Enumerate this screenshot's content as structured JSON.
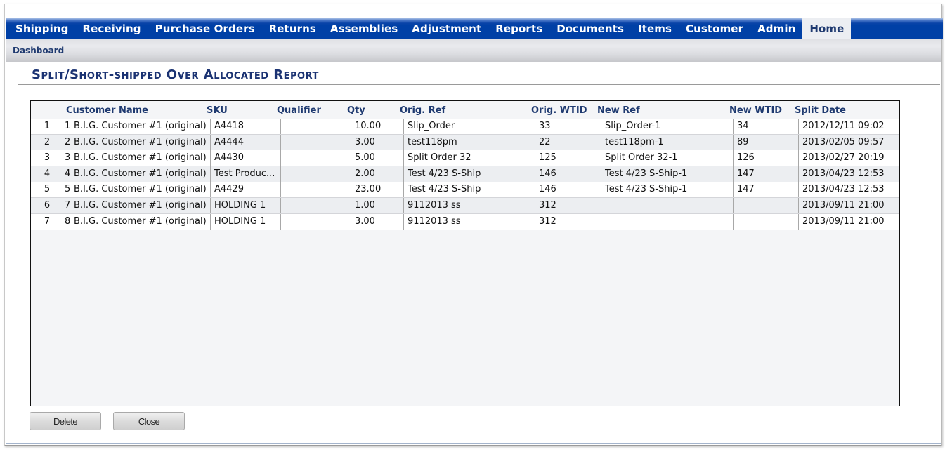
{
  "nav": {
    "items": [
      {
        "label": "Shipping",
        "active": false
      },
      {
        "label": "Receiving",
        "active": false
      },
      {
        "label": "Purchase Orders",
        "active": false
      },
      {
        "label": "Returns",
        "active": false
      },
      {
        "label": "Assemblies",
        "active": false
      },
      {
        "label": "Adjustment",
        "active": false
      },
      {
        "label": "Reports",
        "active": false
      },
      {
        "label": "Documents",
        "active": false
      },
      {
        "label": "Items",
        "active": false
      },
      {
        "label": "Customer",
        "active": false
      },
      {
        "label": "Admin",
        "active": false
      },
      {
        "label": "Home",
        "active": true
      }
    ],
    "active_color": "#0040a6"
  },
  "subnav": {
    "items": [
      {
        "label": "Dashboard"
      }
    ]
  },
  "report": {
    "title": "Split/Short-shipped Over Allocated Report"
  },
  "table": {
    "columns": [
      {
        "key": "row",
        "label": ""
      },
      {
        "key": "id",
        "label": ""
      },
      {
        "key": "customer",
        "label": "Customer Name"
      },
      {
        "key": "sku",
        "label": "SKU"
      },
      {
        "key": "qualifier",
        "label": "Qualifier"
      },
      {
        "key": "qty",
        "label": "Qty"
      },
      {
        "key": "orig_ref",
        "label": "Orig. Ref"
      },
      {
        "key": "orig_wtid",
        "label": "Orig. WTID"
      },
      {
        "key": "new_ref",
        "label": "New Ref"
      },
      {
        "key": "new_wtid",
        "label": "New WTID"
      },
      {
        "key": "split_date",
        "label": "Split Date"
      }
    ],
    "rows": [
      {
        "row": "1",
        "id": "1",
        "customer": "B.I.G. Customer #1 (original)",
        "sku": "A4418",
        "qualifier": "",
        "qty": "10.00",
        "orig_ref": "Slip_Order",
        "orig_wtid": "33",
        "new_ref": "Slip_Order-1",
        "new_wtid": "34",
        "split_date": "2012/12/11 09:02"
      },
      {
        "row": "2",
        "id": "2",
        "customer": "B.I.G. Customer #1 (original)",
        "sku": "A4444",
        "qualifier": "",
        "qty": "3.00",
        "orig_ref": "test118pm",
        "orig_wtid": "22",
        "new_ref": "test118pm-1",
        "new_wtid": "89",
        "split_date": "2013/02/05 09:57"
      },
      {
        "row": "3",
        "id": "3",
        "customer": "B.I.G. Customer #1 (original)",
        "sku": "A4430",
        "qualifier": "",
        "qty": "5.00",
        "orig_ref": "Split Order 32",
        "orig_wtid": "125",
        "new_ref": "Split Order 32-1",
        "new_wtid": "126",
        "split_date": "2013/02/27 20:19"
      },
      {
        "row": "4",
        "id": "4",
        "customer": "B.I.G. Customer #1 (original)",
        "sku": "Test Produc...",
        "qualifier": "",
        "qty": "2.00",
        "orig_ref": "Test 4/23 S-Ship",
        "orig_wtid": "146",
        "new_ref": "Test 4/23 S-Ship-1",
        "new_wtid": "147",
        "split_date": "2013/04/23 12:53"
      },
      {
        "row": "5",
        "id": "5",
        "customer": "B.I.G. Customer #1 (original)",
        "sku": "A4429",
        "qualifier": "",
        "qty": "23.00",
        "orig_ref": "Test 4/23 S-Ship",
        "orig_wtid": "146",
        "new_ref": "Test 4/23 S-Ship-1",
        "new_wtid": "147",
        "split_date": "2013/04/23 12:53"
      },
      {
        "row": "6",
        "id": "7",
        "customer": "B.I.G. Customer #1 (original)",
        "sku": "HOLDING 1",
        "qualifier": "",
        "qty": "1.00",
        "orig_ref": "9112013 ss",
        "orig_wtid": "312",
        "new_ref": "",
        "new_wtid": "",
        "split_date": "2013/09/11 21:00"
      },
      {
        "row": "7",
        "id": "8",
        "customer": "B.I.G. Customer #1 (original)",
        "sku": "HOLDING 1",
        "qualifier": "",
        "qty": "3.00",
        "orig_ref": "9112013 ss",
        "orig_wtid": "312",
        "new_ref": "",
        "new_wtid": "",
        "split_date": "2013/09/11 21:00"
      }
    ]
  },
  "buttons": {
    "delete": "Delete",
    "close": "Close"
  }
}
